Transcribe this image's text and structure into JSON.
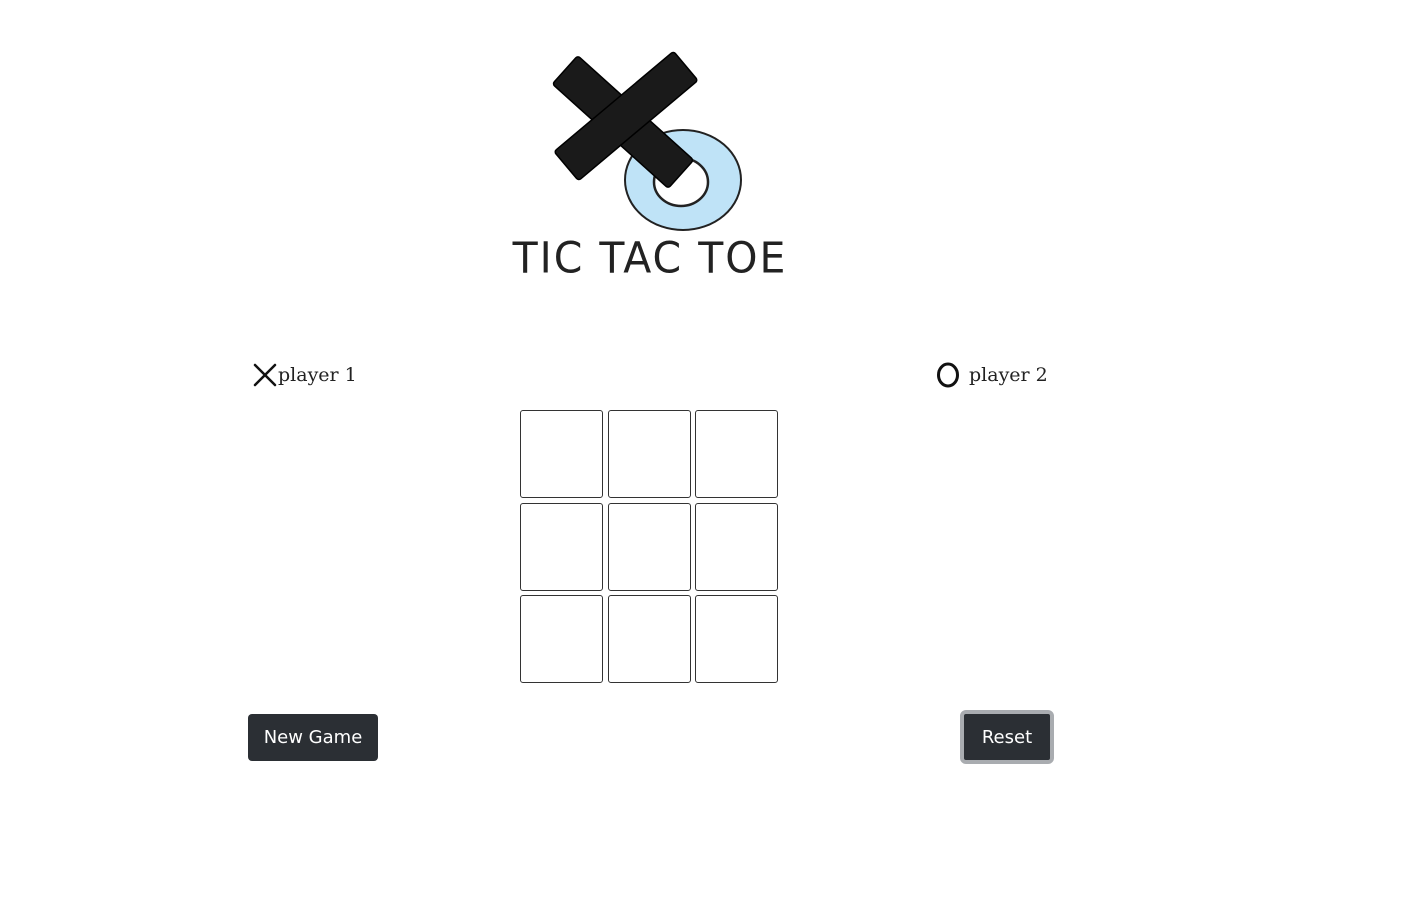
{
  "header": {
    "title": "TIC TAC TOE",
    "logo_icon": "xo-logo-icon"
  },
  "players": [
    {
      "mark": "X",
      "icon": "x-mark-icon",
      "label": "player 1"
    },
    {
      "mark": "O",
      "icon": "o-mark-icon",
      "label": "player 2"
    }
  ],
  "board": {
    "cells": [
      "",
      "",
      "",
      "",
      "",
      "",
      "",
      "",
      ""
    ]
  },
  "controls": {
    "new_game_label": "New Game",
    "reset_label": "Reset"
  },
  "colors": {
    "button_bg": "#2b2f34",
    "button_text": "#ffffff",
    "logo_o_fill": "#bfe3f7",
    "logo_x_fill": "#1a1a1a"
  }
}
